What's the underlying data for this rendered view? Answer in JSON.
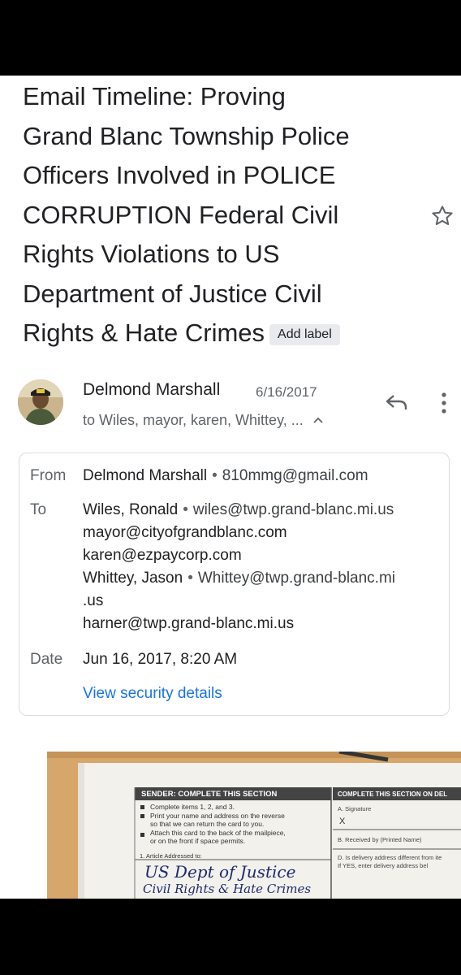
{
  "subject": {
    "lines": [
      "Email Timeline: Proving",
      "Grand Blanc Township Police",
      "Officers Involved in POLICE",
      "CORRUPTION Federal Civil",
      "Rights Violations to US",
      "Department of Justice Civil",
      "Rights & Hate Crimes"
    ],
    "add_label": "Add label"
  },
  "message": {
    "sender_name": "Delmond Marshall",
    "date_short": "6/16/2017",
    "recipients_summary": "to Wiles, mayor, karen, Whittey, ...",
    "icons": {
      "reply": "reply-icon",
      "more": "more-vert-icon",
      "star": "star-icon",
      "expand": "chevron-up-icon"
    }
  },
  "details": {
    "from_label": "From",
    "from_name": "Delmond Marshall",
    "from_email": "810mmg@gmail.com",
    "to_label": "To",
    "to": [
      {
        "name": "Wiles, Ronald",
        "email": "wiles@twp.grand-blanc.mi.us"
      },
      {
        "name": "",
        "email": "mayor@cityofgrandblanc.com"
      },
      {
        "name": "",
        "email": "karen@ezpaycorp.com"
      },
      {
        "name": "Whittey, Jason",
        "email": "Whittey@twp.grand-blanc.mi"
      },
      {
        "name": "",
        "email": ".us"
      },
      {
        "name": "",
        "email": "harner@twp.grand-blanc.mi.us"
      }
    ],
    "date_label": "Date",
    "date_full": "Jun 16, 2017, 8:20 AM",
    "security_link": "View security details"
  },
  "attachment": {
    "sender_header": "SENDER: COMPLETE THIS SECTION",
    "delivery_header": "COMPLETE THIS SECTION ON DEL",
    "instructions": [
      "Complete items 1, 2, and 3.",
      "Print your name and address on the reverse",
      "so that we can return the card to you.",
      "Attach this card to the back of the mailpiece,",
      "or on the front if space permits."
    ],
    "article_label": "1. Article Addressed to:",
    "signature_label": "A. Signature",
    "signature_mark": "X",
    "received_label": "B. Received by (Printed Name)",
    "delivery_q1": "D. Is delivery address different from ite",
    "delivery_q2": "If YES, enter delivery address bel",
    "handwritten_1": "US Dept of Justice",
    "handwritten_2": "Civil Rights & Hate Crimes"
  },
  "colors": {
    "link": "#1a73e8",
    "text": "#202124",
    "secondary": "#5f6368",
    "envelope": "#d8a869"
  }
}
